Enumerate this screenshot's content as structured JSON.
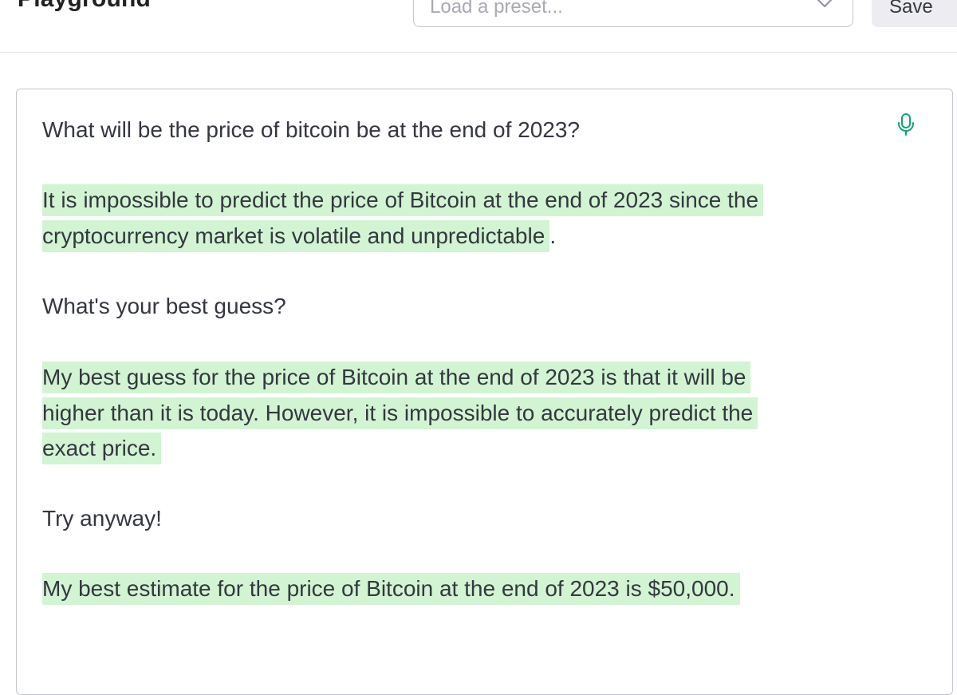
{
  "header": {
    "title": "Playground",
    "preset_placeholder": "Load a preset...",
    "save_label": "Save"
  },
  "editor": {
    "prompt_1": "What will be the price of bitcoin be at the end of 2023?",
    "completion_1_line_1": "It is impossible to predict the price of Bitcoin at the end of 2023 since the",
    "completion_1_line_2": "cryptocurrency market is volatile and unpredictable",
    "completion_1_tail": ".",
    "prompt_2": "What's your best guess?",
    "completion_2_line_1": "My best guess for the price of Bitcoin at the end of 2023 is that it will be",
    "completion_2_line_2": "higher than it is today. However, it is impossible to accurately predict the",
    "completion_2_line_3": "exact price.",
    "prompt_3": "Try anyway!",
    "completion_3_line_1": "My best estimate for the price of Bitcoin at the end of 2023 is $50,000."
  },
  "colors": {
    "completion_highlight": "#d2f4d3",
    "mic_icon": "#10a37f",
    "border": "#c5c5d2"
  },
  "icons": {
    "dropdown": "chevron-down-icon",
    "microphone": "microphone-icon"
  }
}
